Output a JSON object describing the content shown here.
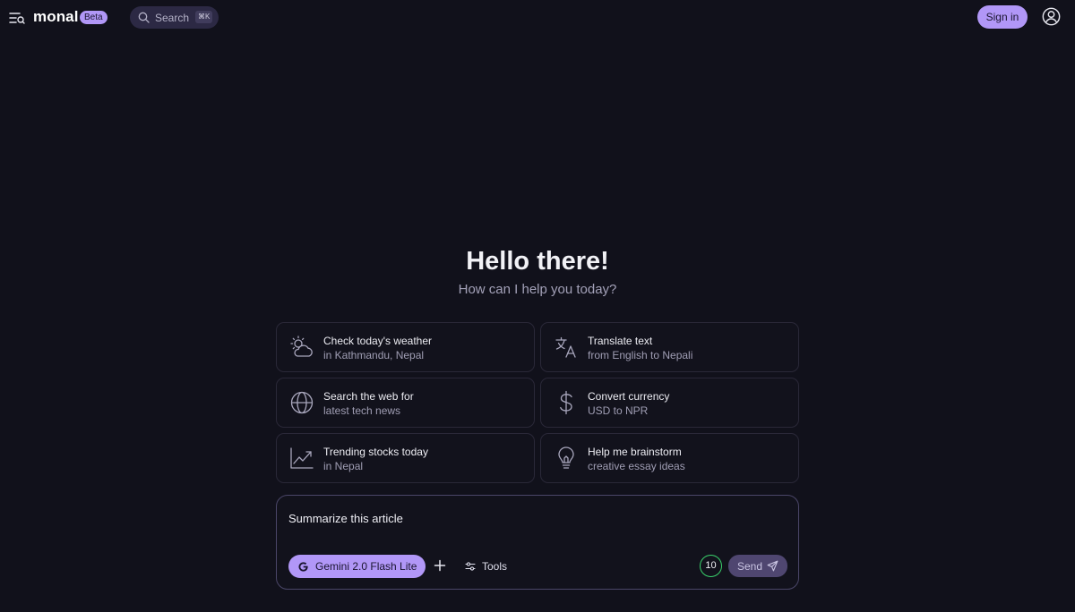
{
  "header": {
    "brand": "monal",
    "badge": "Beta",
    "search_label": "Search",
    "search_shortcut": "⌘K",
    "signin_label": "Sign in"
  },
  "hero": {
    "title": "Hello there!",
    "subtitle": "How can I help you today?"
  },
  "suggestions": [
    {
      "title": "Check today's weather",
      "subtitle": "in Kathmandu, Nepal",
      "icon": "weather-icon"
    },
    {
      "title": "Translate text",
      "subtitle": "from English to Nepali",
      "icon": "translate-icon"
    },
    {
      "title": "Search the web for",
      "subtitle": "latest tech news",
      "icon": "globe-icon"
    },
    {
      "title": "Convert currency",
      "subtitle": "USD to NPR",
      "icon": "dollar-icon"
    },
    {
      "title": "Trending stocks today",
      "subtitle": "in Nepal",
      "icon": "trend-chart-icon"
    },
    {
      "title": "Help me brainstorm",
      "subtitle": "creative essay ideas",
      "icon": "lightbulb-icon"
    }
  ],
  "composer": {
    "input_value": "Summarize this article",
    "model_label": "Gemini 2.0 Flash Lite",
    "tools_label": "Tools",
    "credits": "10",
    "send_label": "Send"
  },
  "colors": {
    "background": "#11111b",
    "accent": "#b197f7",
    "credit_ring": "#3ad26c"
  }
}
